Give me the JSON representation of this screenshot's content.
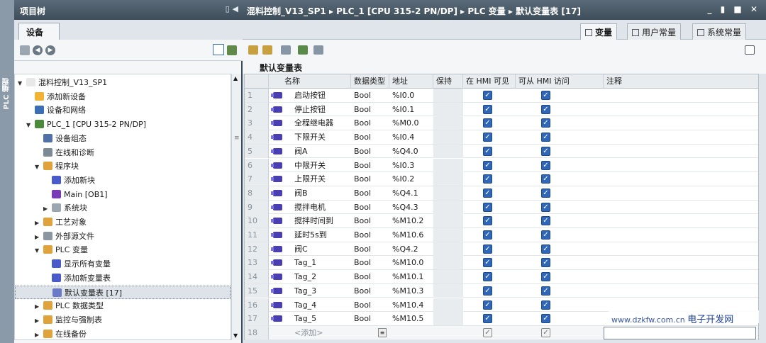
{
  "sidebar_strip": {
    "label": "PLC 编程"
  },
  "tree_panel": {
    "title": "项目树",
    "tab_label": "设备",
    "items": [
      {
        "label": "混料控制_V13_SP1",
        "indent": 0,
        "arrow": "▼",
        "icon_color": "#e8e8e8"
      },
      {
        "label": "添加新设备",
        "indent": 1,
        "arrow": "",
        "icon_color": "#f2b233"
      },
      {
        "label": "设备和网络",
        "indent": 1,
        "arrow": "",
        "icon_color": "#3a6fb8"
      },
      {
        "label": "PLC_1 [CPU 315-2 PN/DP]",
        "indent": 1,
        "arrow": "▼",
        "icon_color": "#4a8a3a"
      },
      {
        "label": "设备组态",
        "indent": 2,
        "arrow": "",
        "icon_color": "#5070a8"
      },
      {
        "label": "在线和诊断",
        "indent": 2,
        "arrow": "",
        "icon_color": "#7c8a96"
      },
      {
        "label": "程序块",
        "indent": 2,
        "arrow": "▼",
        "icon_color": "#e0a23a"
      },
      {
        "label": "添加新块",
        "indent": 3,
        "arrow": "",
        "icon_color": "#4a5ac8"
      },
      {
        "label": "Main [OB1]",
        "indent": 3,
        "arrow": "",
        "icon_color": "#7a3ab8"
      },
      {
        "label": "系统块",
        "indent": 3,
        "arrow": "▶",
        "icon_color": "#9aa6b0"
      },
      {
        "label": "工艺对象",
        "indent": 2,
        "arrow": "▶",
        "icon_color": "#e0a23a"
      },
      {
        "label": "外部源文件",
        "indent": 2,
        "arrow": "▶",
        "icon_color": "#8a96a2"
      },
      {
        "label": "PLC 变量",
        "indent": 2,
        "arrow": "▼",
        "icon_color": "#e0a23a"
      },
      {
        "label": "显示所有变量",
        "indent": 3,
        "arrow": "",
        "icon_color": "#4a5ac8"
      },
      {
        "label": "添加新变量表",
        "indent": 3,
        "arrow": "",
        "icon_color": "#4a5ac8"
      },
      {
        "label": "默认变量表 [17]",
        "indent": 3,
        "arrow": "",
        "icon_color": "#6a7ac8",
        "selected": true
      },
      {
        "label": "PLC 数据类型",
        "indent": 2,
        "arrow": "▶",
        "icon_color": "#e0a23a"
      },
      {
        "label": "监控与强制表",
        "indent": 2,
        "arrow": "▶",
        "icon_color": "#e0a23a"
      },
      {
        "label": "在线备份",
        "indent": 2,
        "arrow": "▶",
        "icon_color": "#e0a23a"
      }
    ]
  },
  "main": {
    "breadcrumb": "混料控制_V13_SP1 ▸ PLC_1 [CPU 315-2 PN/DP] ▸ PLC 变量 ▸ 默认变量表 [17]",
    "window_controls": "_ ▮ ■ ✕",
    "tabs": [
      {
        "label": "变量",
        "active": true
      },
      {
        "label": "用户常量",
        "active": false
      },
      {
        "label": "系统常量",
        "active": false
      }
    ],
    "table_title": "默认变量表",
    "columns": [
      "",
      "名称",
      "数据类型",
      "地址",
      "保持",
      "在 HMI 可见",
      "可从 HMI 访问",
      "注释"
    ],
    "rows": [
      {
        "num": "1",
        "name": "启动按钮",
        "type": "Bool",
        "addr": "%I0.0"
      },
      {
        "num": "2",
        "name": "停止按钮",
        "type": "Bool",
        "addr": "%I0.1"
      },
      {
        "num": "3",
        "name": "全程继电器",
        "type": "Bool",
        "addr": "%M0.0"
      },
      {
        "num": "4",
        "name": "下限开关",
        "type": "Bool",
        "addr": "%I0.4"
      },
      {
        "num": "5",
        "name": "阀A",
        "type": "Bool",
        "addr": "%Q4.0"
      },
      {
        "num": "6",
        "name": "中限开关",
        "type": "Bool",
        "addr": "%I0.3"
      },
      {
        "num": "7",
        "name": "上限开关",
        "type": "Bool",
        "addr": "%I0.2"
      },
      {
        "num": "8",
        "name": "阀B",
        "type": "Bool",
        "addr": "%Q4.1"
      },
      {
        "num": "9",
        "name": "搅拌电机",
        "type": "Bool",
        "addr": "%Q4.3"
      },
      {
        "num": "10",
        "name": "搅拌时间到",
        "type": "Bool",
        "addr": "%M10.2"
      },
      {
        "num": "11",
        "name": "延时5s到",
        "type": "Bool",
        "addr": "%M10.6"
      },
      {
        "num": "12",
        "name": "阀C",
        "type": "Bool",
        "addr": "%Q4.2"
      },
      {
        "num": "13",
        "name": "Tag_1",
        "type": "Bool",
        "addr": "%M10.0"
      },
      {
        "num": "14",
        "name": "Tag_2",
        "type": "Bool",
        "addr": "%M10.1"
      },
      {
        "num": "15",
        "name": "Tag_3",
        "type": "Bool",
        "addr": "%M10.3"
      },
      {
        "num": "16",
        "name": "Tag_4",
        "type": "Bool",
        "addr": "%M10.4"
      },
      {
        "num": "17",
        "name": "Tag_5",
        "type": "Bool",
        "addr": "%M10.5"
      }
    ],
    "add_row": {
      "num": "18",
      "name": "<添加>"
    }
  },
  "watermark": {
    "url": "www.dzkfw.com.cn",
    "brand": "电子开发网"
  }
}
